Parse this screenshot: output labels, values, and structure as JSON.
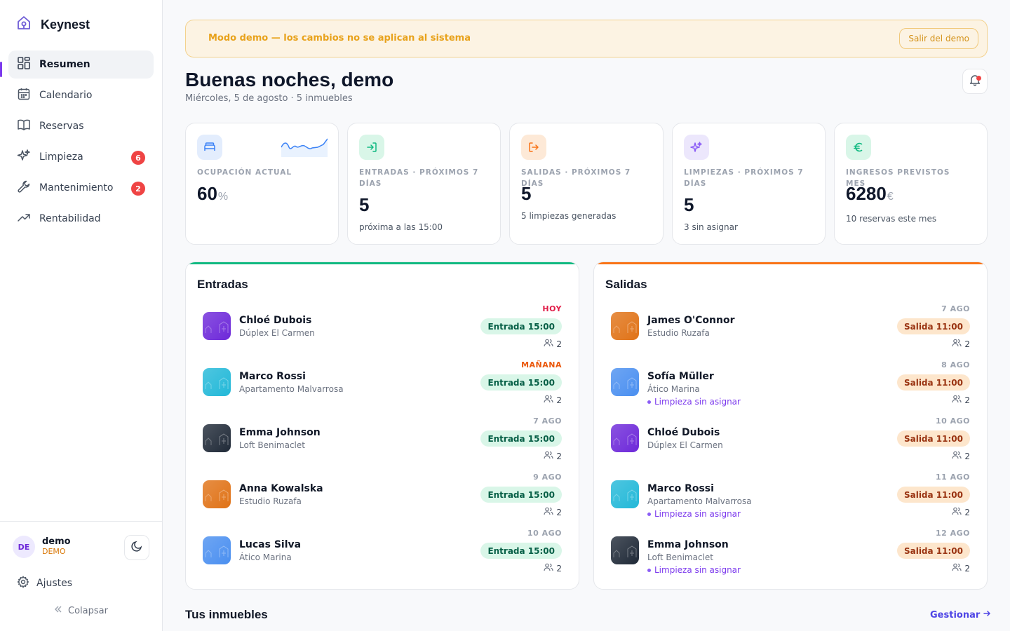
{
  "app": {
    "name": "Keynest",
    "accent": "#7c3aed"
  },
  "sidebar": {
    "items": [
      {
        "label": "Resumen",
        "icon": "dashboard-icon",
        "active": true
      },
      {
        "label": "Calendario",
        "icon": "calendar-icon"
      },
      {
        "label": "Reservas",
        "icon": "book-icon"
      },
      {
        "label": "Limpieza",
        "icon": "sparkles-icon",
        "badge": "6"
      },
      {
        "label": "Mantenimiento",
        "icon": "wrench-icon",
        "badge": "2"
      },
      {
        "label": "Rentabilidad",
        "icon": "trending-up-icon"
      }
    ],
    "user": {
      "initials": "DE",
      "name": "demo",
      "role": "DEMO"
    },
    "settings_label": "Ajustes",
    "collapse_label": "Colapsar"
  },
  "banner": {
    "text": "Modo demo — los cambios no se aplican al sistema",
    "button": "Salir del demo"
  },
  "header": {
    "greeting": "Buenas noches, demo",
    "subline": "Miércoles, 5 de agosto · 5 inmuebles"
  },
  "kpis": [
    {
      "label": "OCUPACIÓN ACTUAL",
      "value": "60",
      "unit": "%",
      "sub": "",
      "color": "#3b82f6"
    },
    {
      "label": "ENTRADAS · PRÓXIMOS 7 DÍAS",
      "value": "5",
      "unit": "",
      "sub": "próxima a las 15:00",
      "color": "#10b981"
    },
    {
      "label": "SALIDAS · PRÓXIMOS 7 DÍAS",
      "value": "5",
      "unit": "",
      "sub": "5 limpiezas generadas",
      "color": "#f97316"
    },
    {
      "label": "LIMPIEZAS · PRÓXIMOS 7 DÍAS",
      "value": "5",
      "unit": "",
      "sub": "3 sin asignar",
      "color": "#8b5cf6"
    },
    {
      "label": "INGRESOS PREVISTOS MES",
      "value": "6280",
      "unit": "€",
      "sub": "10 reservas este mes",
      "color": "#10b981"
    }
  ],
  "arrivals": {
    "title": "Entradas",
    "rows": [
      {
        "date": "HOY",
        "date_color": "#e11d48",
        "guest": "Chloé Dubois",
        "property": "Dúplex El Carmen",
        "pill": "Entrada 15:00",
        "guests": "2",
        "warn": ""
      },
      {
        "date": "MAÑANA",
        "date_color": "#ea580c",
        "guest": "Marco Rossi",
        "property": "Apartamento Malvarrosa",
        "pill": "Entrada 15:00",
        "guests": "2",
        "warn": ""
      },
      {
        "date": "7 AGO",
        "date_color": "#9ca3af",
        "guest": "Emma Johnson",
        "property": "Loft Benimaclet",
        "pill": "Entrada 15:00",
        "guests": "2",
        "warn": ""
      },
      {
        "date": "9 AGO",
        "date_color": "#9ca3af",
        "guest": "Anna Kowalska",
        "property": "Estudio Ruzafa",
        "pill": "Entrada 15:00",
        "guests": "2",
        "warn": ""
      },
      {
        "date": "10 AGO",
        "date_color": "#9ca3af",
        "guest": "Lucas Silva",
        "property": "Ático Marina",
        "pill": "Entrada 15:00",
        "guests": "2",
        "warn": ""
      }
    ]
  },
  "departures": {
    "title": "Salidas",
    "rows": [
      {
        "date": "7 AGO",
        "date_color": "#9ca3af",
        "guest": "James O'Connor",
        "property": "Estudio Ruzafa",
        "pill": "Salida 11:00",
        "guests": "2",
        "warn": ""
      },
      {
        "date": "8 AGO",
        "date_color": "#9ca3af",
        "guest": "Sofía Müller",
        "property": "Ático Marina",
        "pill": "Salida 11:00",
        "guests": "2",
        "warn": "Limpieza sin asignar"
      },
      {
        "date": "10 AGO",
        "date_color": "#9ca3af",
        "guest": "Chloé Dubois",
        "property": "Dúplex El Carmen",
        "pill": "Salida 11:00",
        "guests": "2",
        "warn": ""
      },
      {
        "date": "11 AGO",
        "date_color": "#9ca3af",
        "guest": "Marco Rossi",
        "property": "Apartamento Malvarrosa",
        "pill": "Salida 11:00",
        "guests": "2",
        "warn": "Limpieza sin asignar"
      },
      {
        "date": "12 AGO",
        "date_color": "#9ca3af",
        "guest": "Emma Johnson",
        "property": "Loft Benimaclet",
        "pill": "Salida 11:00",
        "guests": "2",
        "warn": "Limpieza sin asignar"
      }
    ]
  },
  "properties_section": {
    "title": "Tus inmuebles",
    "link": "Gestionar"
  },
  "property_colors": {
    "Dúplex El Carmen": "#6d28d9",
    "Apartamento Malvarrosa": "#22b8d8",
    "Loft Benimaclet": "#1f2937",
    "Estudio Ruzafa": "#e07216",
    "Ático Marina": "#4a8ff0"
  }
}
